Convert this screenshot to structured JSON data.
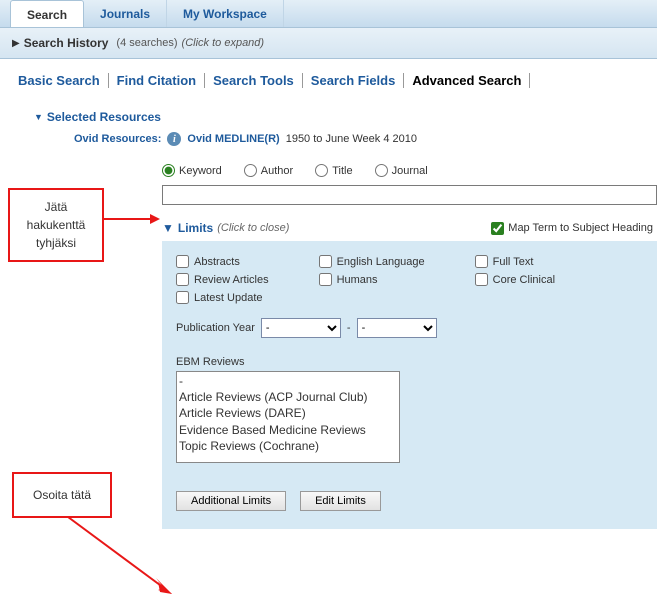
{
  "tabs": {
    "search": "Search",
    "journals": "Journals",
    "workspace": "My Workspace"
  },
  "history": {
    "title": "Search History",
    "count": "(4 searches)",
    "expand": "(Click to expand)"
  },
  "subtabs": {
    "basic": "Basic Search",
    "citation": "Find Citation",
    "tools": "Search Tools",
    "fields": "Search Fields",
    "advanced": "Advanced Search"
  },
  "resources": {
    "header": "Selected Resources",
    "label": "Ovid Resources:",
    "name": "Ovid MEDLINE(R)",
    "range": "1950 to June Week 4 2010"
  },
  "searchType": {
    "keyword": "Keyword",
    "author": "Author",
    "title": "Title",
    "journal": "Journal"
  },
  "limits": {
    "title": "Limits",
    "hint": "(Click to close)",
    "mapTerm": "Map Term to Subject Heading",
    "col1": {
      "abstracts": "Abstracts",
      "review": "Review Articles",
      "latest": "Latest Update"
    },
    "col2": {
      "english": "English Language",
      "humans": "Humans"
    },
    "col3": {
      "fulltext": "Full Text",
      "core": "Core Clinical"
    },
    "pubyear": "Publication Year",
    "dash": "-",
    "ebmLabel": "EBM Reviews",
    "ebm": {
      "blank": "-",
      "acp": "Article Reviews (ACP Journal Club)",
      "dare": "Article Reviews (DARE)",
      "ebmr": "Evidence Based Medicine Reviews",
      "cochrane": "Topic Reviews (Cochrane)"
    },
    "addlBtn": "Additional Limits",
    "editBtn": "Edit Limits"
  },
  "callouts": {
    "c1a": "Jätä",
    "c1b": "hakukenttä",
    "c1c": "tyhjäksi",
    "c2": "Osoita tätä"
  }
}
